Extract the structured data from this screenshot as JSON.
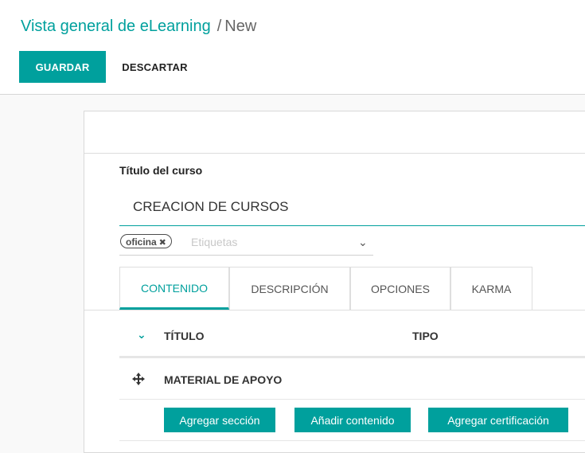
{
  "breadcrumb": {
    "parent": "Vista general de eLearning",
    "separator": "/",
    "current": "New"
  },
  "toolbar": {
    "save_label": "GUARDAR",
    "discard_label": "DESCARTAR"
  },
  "form": {
    "title_label": "Título del curso",
    "title_value": "CREACION DE CURSOS",
    "tags": {
      "items": [
        {
          "label": "oficina",
          "remove_icon": "times-icon"
        }
      ],
      "placeholder": "Etiquetas",
      "dropdown_icon": "chevron-down-icon"
    },
    "tabs": [
      {
        "label": "CONTENIDO",
        "active": true
      },
      {
        "label": "DESCRIPCIÓN",
        "active": false
      },
      {
        "label": "OPCIONES",
        "active": false
      },
      {
        "label": "KARMA",
        "active": false
      }
    ],
    "content_table": {
      "columns": [
        "TÍTULO",
        "TIPO"
      ],
      "rows": [
        {
          "title": "MATERIAL DE APOYO",
          "type": "",
          "drag_icon": "move-icon"
        }
      ],
      "actions": [
        {
          "label": "Agregar sección"
        },
        {
          "label": "Añadir contenido"
        },
        {
          "label": "Agregar certificación"
        }
      ]
    }
  },
  "colors": {
    "accent": "#00a09d",
    "text": "#4c4c4c",
    "background": "#f9f9f9"
  }
}
